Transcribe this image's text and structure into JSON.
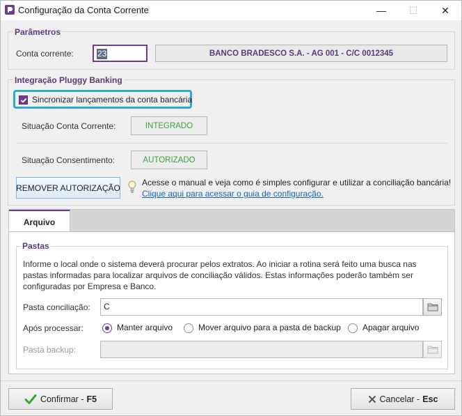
{
  "window": {
    "title": "Configuração da Conta Corrente",
    "controls": {
      "minimize": "—",
      "maximize": "☐",
      "close": "✕"
    }
  },
  "params": {
    "legend": "Parâmetros",
    "account_label": "Conta corrente:",
    "account_value": "23",
    "bank_info": "BANCO BRADESCO S.A. - AG 001 - C/C 0012345"
  },
  "pluggy": {
    "legend": "Integração Pluggy Banking",
    "sync_checkbox_label": "Sincronizar lançamentos da conta bancária",
    "sync_checked": true,
    "account_status_label": "Situação Conta Corrente:",
    "account_status_value": "INTEGRADO",
    "consent_status_label": "Situação Consentimento:",
    "consent_status_value": "AUTORIZADO",
    "remove_button": "REMOVER AUTORIZAÇÃO",
    "info_text": "Acesse o manual e veja como é simples configurar e utilizar a conciliação bancária!",
    "info_link": "Clique aqui para acessar o guia de configuração."
  },
  "tabs": [
    {
      "label": "Arquivo",
      "active": true
    }
  ],
  "folders": {
    "legend": "Pastas",
    "description": "Informe o local onde o sistema deverá procurar pelos extratos. Ao iniciar a rotina será feito uma busca nas pastas informadas para localizar arquivos de conciliação válidos. Estas informações poderão também ser configuradas por Empresa e Banco.",
    "reconcile_label": "Pasta conciliação:",
    "reconcile_value": "C",
    "after_label": "Após processar:",
    "options": [
      "Manter arquivo",
      "Mover arquivo para a pasta de backup",
      "Apagar arquivo"
    ],
    "selected_option": "Manter arquivo",
    "backup_label": "Pasta backup:",
    "backup_value": ""
  },
  "footer": {
    "confirm_label": "Confirmar -",
    "confirm_key": "F5",
    "cancel_label": "Cancelar -",
    "cancel_key": "Esc"
  },
  "colors": {
    "accent": "#6a3d8f",
    "status_ok": "#3aa43a",
    "highlight": "#29a9e0",
    "link": "#1565c0"
  }
}
